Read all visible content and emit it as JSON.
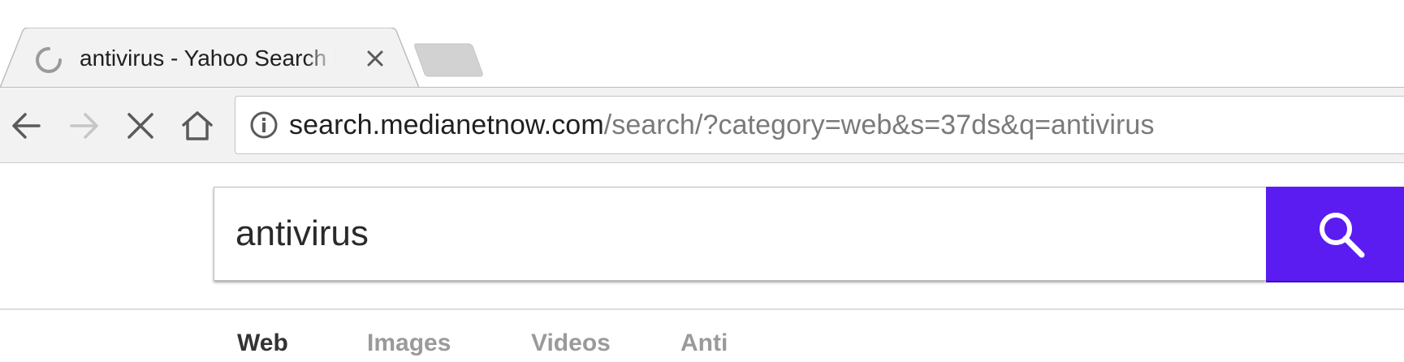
{
  "browser": {
    "tab": {
      "title": "antivirus - Yahoo Search Results",
      "loading": true
    },
    "address_bar": {
      "host": "search.medianetnow.com",
      "path": "/search/?category=web&s=37ds&q=antivirus"
    },
    "icons": {
      "back": "arrow-left-icon",
      "forward": "arrow-right-icon",
      "stop": "close-icon",
      "home": "home-icon",
      "site_info": "info-icon"
    }
  },
  "search": {
    "query": "antivirus",
    "button_icon": "search-icon",
    "button_color": "#5b1cf2"
  },
  "nav": {
    "items": [
      "Web",
      "Images",
      "Videos",
      "Anti"
    ]
  }
}
